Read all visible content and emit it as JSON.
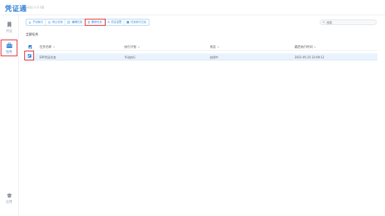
{
  "app": {
    "title": "凭证通",
    "subtitle": "折扣后-1.0.1版"
  },
  "sidebar": {
    "items": [
      {
        "label": "凭证",
        "icon": "bookmark-icon",
        "active": false
      },
      {
        "label": "任务",
        "icon": "briefcase-icon",
        "active": true
      },
      {
        "label": "应用",
        "icon": "graduation-cap-icon",
        "active": false
      }
    ]
  },
  "toolbar": {
    "buttons": [
      {
        "label": "手动执行",
        "icon": "download-icon"
      },
      {
        "label": "终止任务",
        "icon": "power-icon"
      },
      {
        "label": "编辑任务",
        "icon": "edit-icon"
      },
      {
        "label": "删除任务",
        "icon": "trash-icon"
      },
      {
        "label": "凭证设置",
        "icon": "wrench-icon"
      },
      {
        "label": "任务执行日志",
        "icon": "log-icon"
      }
    ],
    "highlighted": "删除任务"
  },
  "search": {
    "placeholder": "搜索",
    "value": ""
  },
  "section": {
    "title": "全部任务"
  },
  "table": {
    "columns": [
      "任务名称",
      "执行计划",
      "状态",
      "最后执行时间"
    ],
    "rows": [
      {
        "selected": true,
        "cells": [
          "ERP凭证任务",
          "手动执行",
          "启用中",
          "2021-05-25 22:09:12"
        ]
      }
    ]
  },
  "colors": {
    "accent": "#2f7fd6",
    "highlight_box": "#e0252b",
    "row_selected": "#e8f3fd"
  }
}
